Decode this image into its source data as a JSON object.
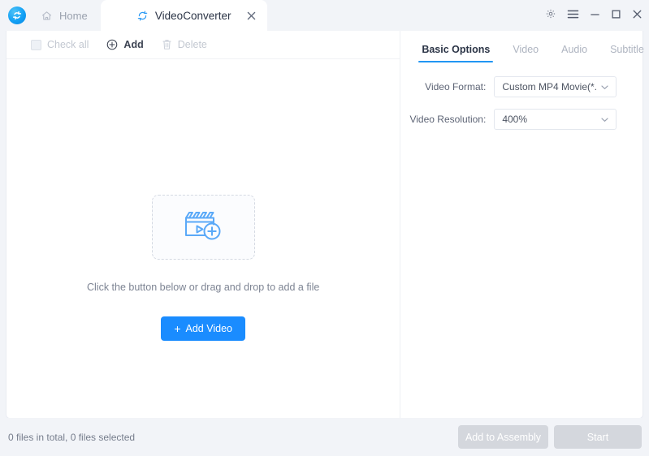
{
  "titlebar": {
    "logo_icon": "app-logo-swirl-icon",
    "tabs": [
      {
        "label": "Home",
        "icon": "home-icon",
        "active": false
      },
      {
        "label": "VideoConverter",
        "icon": "convert-arrows-icon",
        "active": true,
        "close_icon": "close-icon"
      }
    ],
    "window_controls": [
      {
        "name": "settings-gear-icon",
        "label": ""
      },
      {
        "name": "menu-hamburger-icon",
        "label": ""
      },
      {
        "name": "minimize-icon",
        "label": ""
      },
      {
        "name": "maximize-icon",
        "label": ""
      },
      {
        "name": "close-window-icon",
        "label": ""
      }
    ]
  },
  "toolbar": {
    "check_all_label": "Check all",
    "add_label": "Add",
    "delete_label": "Delete"
  },
  "dropzone": {
    "icon": "add-video-clapperboard-icon",
    "hint": "Click the button below or drag and drop to add a file",
    "add_button_label": "Add Video",
    "add_button_plus": "+"
  },
  "options": {
    "tabs": [
      {
        "label": "Basic Options",
        "active": true
      },
      {
        "label": "Video",
        "active": false
      },
      {
        "label": "Audio",
        "active": false
      },
      {
        "label": "Subtitle",
        "active": false
      }
    ],
    "fields": [
      {
        "label": "Video Format:",
        "value": "Custom MP4 Movie(*...",
        "icon": "chevron-down-icon"
      },
      {
        "label": "Video Resolution:",
        "value": "400%",
        "icon": "chevron-down-icon"
      }
    ]
  },
  "footer": {
    "status": "0 files in total, 0 files selected",
    "add_to_assembly_label": "Add to Assembly",
    "start_label": "Start"
  },
  "colors": {
    "accent": "#1a8cff",
    "tab_underline": "#2196f3",
    "icon_blue": "#5aa9f8",
    "disabled_button": "#d4d7dd",
    "window_bg": "#f2f4f8"
  }
}
